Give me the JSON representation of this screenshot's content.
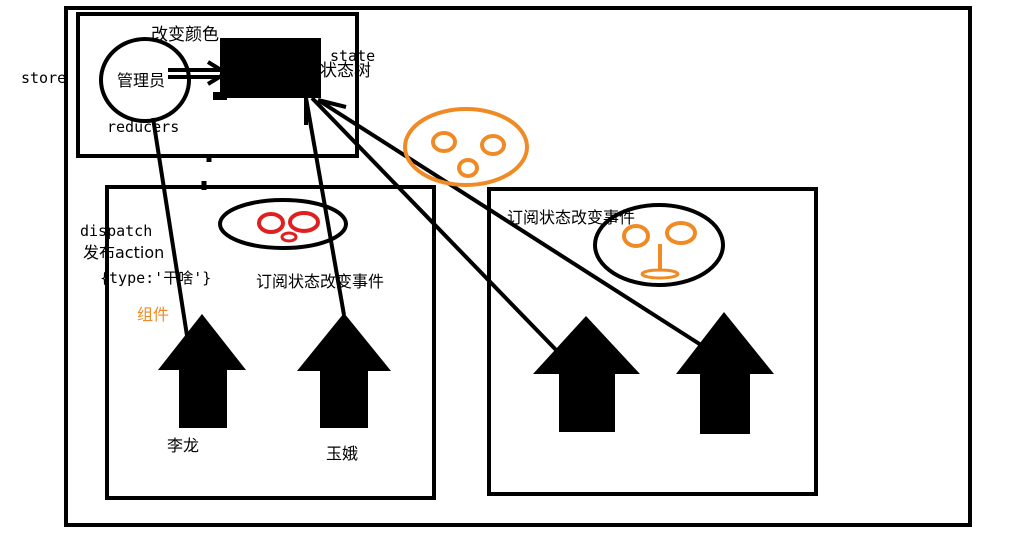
{
  "labels": {
    "store": "store",
    "change_color": "改变颜色",
    "admin": "管理员",
    "state": "state",
    "state_tree": "状态树",
    "reducers": "reducers",
    "dispatch": "dispatch",
    "publish_action": "发布action",
    "action_obj": "{type:'干啥'}",
    "component": "组件",
    "subscribe_middle": "订阅状态改变事件",
    "subscribe_right": "订阅状态改变事件",
    "person_1": "李龙",
    "person_2": "玉娥"
  },
  "colors": {
    "stroke": "#000000",
    "red_face": "#e02020",
    "orange_face": "#f08a24",
    "component_label": "#f08a24"
  },
  "icons": [
    "admin-circle",
    "state-tree-block",
    "red-face-icon",
    "orange-face-icon",
    "up-arrow-icon"
  ]
}
